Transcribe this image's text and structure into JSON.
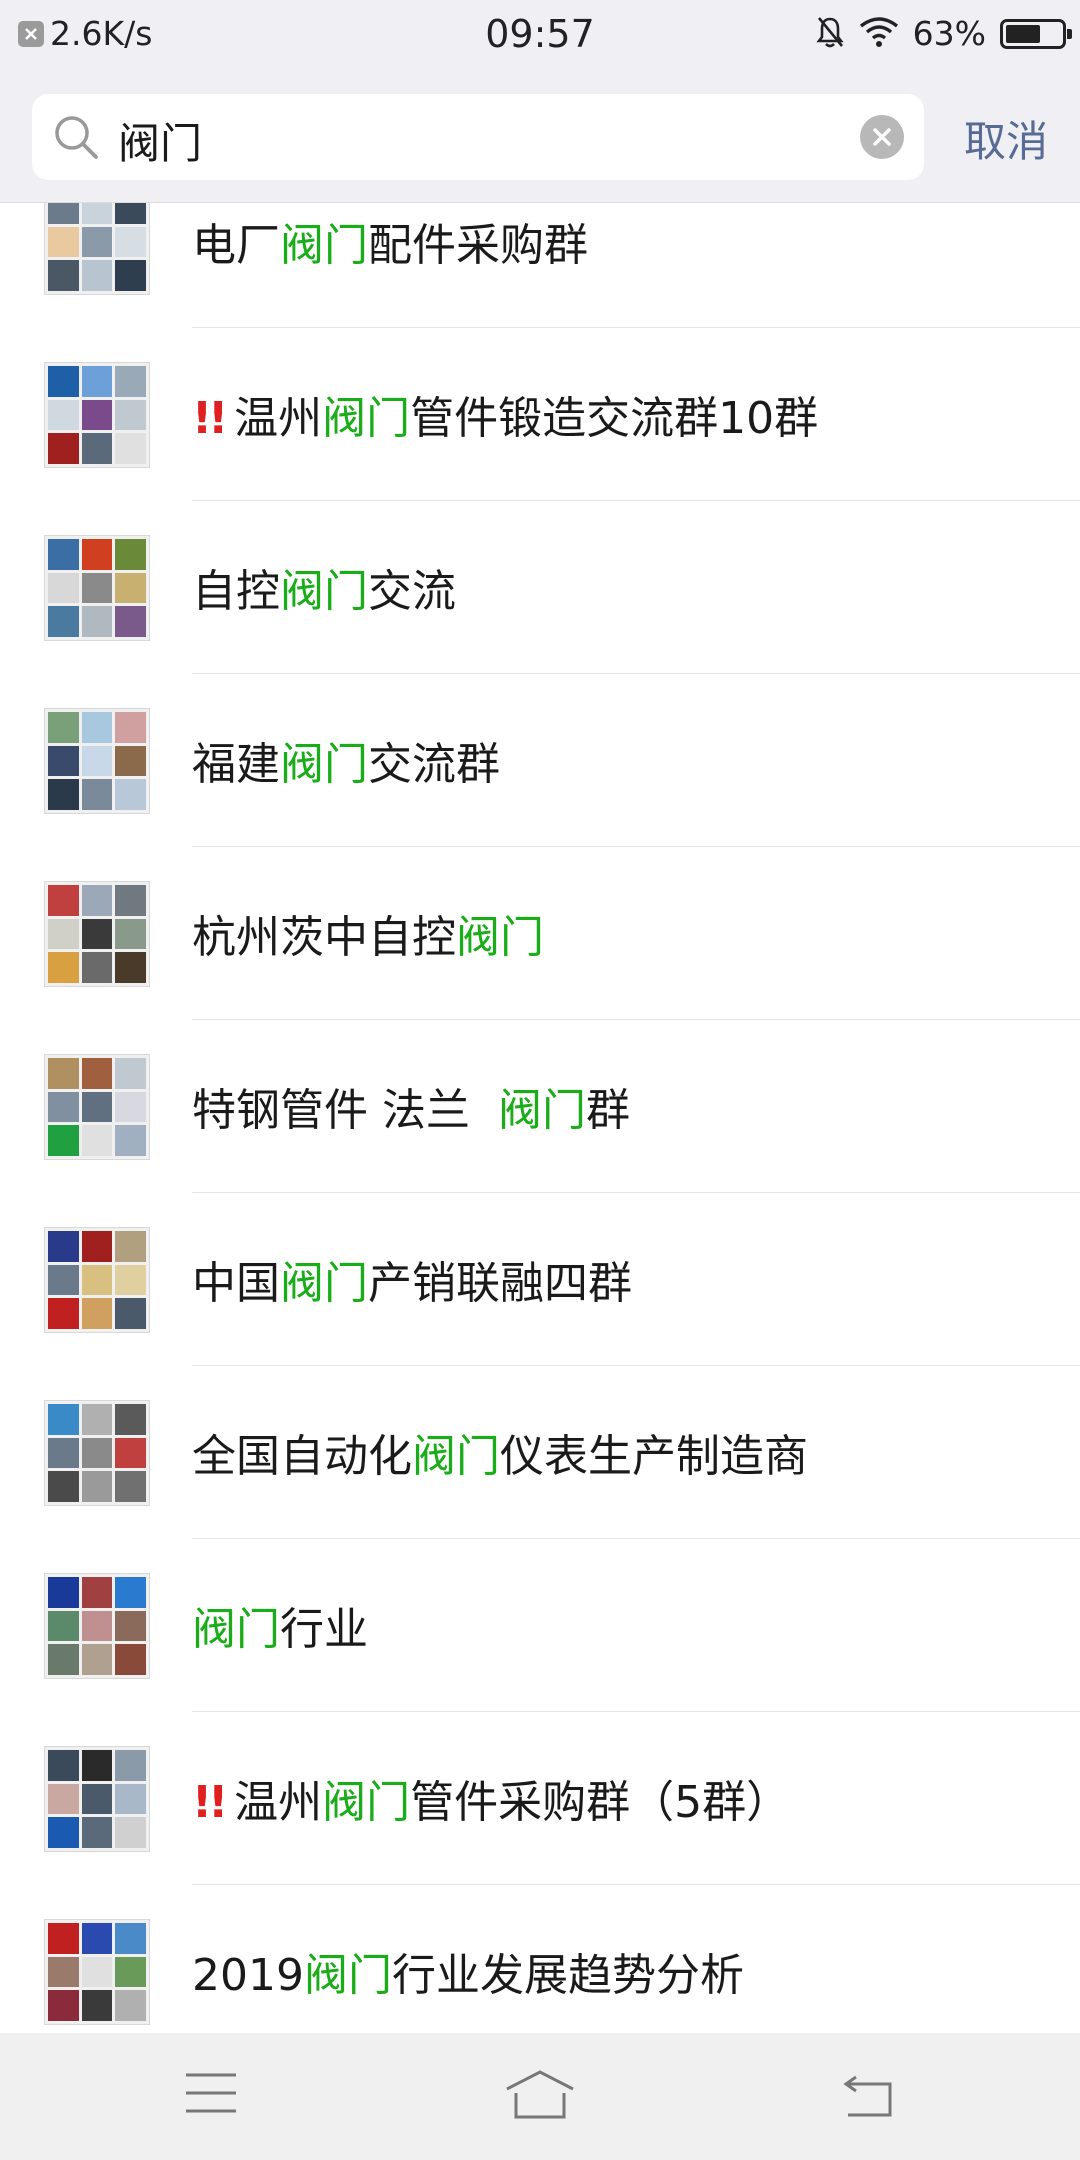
{
  "status_bar": {
    "network_speed": "2.6K/s",
    "time": "09:57",
    "battery_percent": "63%",
    "battery_level": 0.63,
    "icons": [
      "close-icon",
      "bell-off-icon",
      "wifi-icon",
      "battery-icon"
    ]
  },
  "search": {
    "query": "阀门",
    "cancel_label": "取消",
    "icons": [
      "search-icon",
      "clear-icon"
    ]
  },
  "results": [
    {
      "prefix": "",
      "before": "电厂",
      "highlight": "阀门",
      "after": "配件采购群"
    },
    {
      "prefix": "‼️",
      "before": "温州",
      "highlight": "阀门",
      "after": "管件锻造交流群10群"
    },
    {
      "prefix": "",
      "before": "自控",
      "highlight": "阀门",
      "after": "交流"
    },
    {
      "prefix": "",
      "before": "福建",
      "highlight": "阀门",
      "after": "交流群"
    },
    {
      "prefix": "",
      "before": "杭州茨中自控",
      "highlight": "阀门",
      "after": ""
    },
    {
      "prefix": "",
      "before": "特钢管件 法兰  ",
      "highlight": "阀门",
      "after": "群"
    },
    {
      "prefix": "",
      "before": "中国",
      "highlight": "阀门",
      "after": "产销联融四群"
    },
    {
      "prefix": "",
      "before": "全国自动化",
      "highlight": "阀门",
      "after": "仪表生产制造商"
    },
    {
      "prefix": "",
      "before": "",
      "highlight": "阀门",
      "after": "行业"
    },
    {
      "prefix": "‼️",
      "before": "温州",
      "highlight": "阀门",
      "after": "管件采购群（5群）"
    },
    {
      "prefix": "",
      "before": "2019",
      "highlight": "阀门",
      "after": "行业发展趋势分析"
    }
  ],
  "nav_bar": {
    "icons": [
      "menu-icon",
      "home-icon",
      "back-icon"
    ]
  },
  "colors": {
    "highlight": "#1aad19",
    "cancel": "#576b95",
    "warning": "#e02020",
    "header_bg": "#efeff4"
  }
}
